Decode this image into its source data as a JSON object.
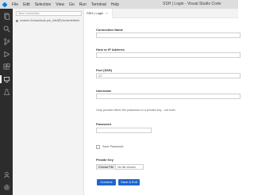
{
  "window": {
    "title": "SSH | Login - Visual Studio Code",
    "menu": [
      "File",
      "Edit",
      "Selection",
      "View",
      "Go",
      "Run",
      "Terminal",
      "Help"
    ]
  },
  "sidebar": {
    "search_placeholder": "Save connection",
    "items": [
      {
        "label": "modem-2x/macbook-pro_Intel(R)/home/redtest"
      }
    ]
  },
  "editor": {
    "tab_label": "SSH | Login",
    "form": {
      "connection_name_label": "Connection Name",
      "connection_name_value": "",
      "host_label": "Host or IP Address",
      "host_value": "",
      "port_label": "Port (SSH)",
      "port_value": "22",
      "username_label": "Username",
      "username_value": "",
      "hint": "Only provide either the password or a private key - not both.",
      "password_label": "Password",
      "password_value": "",
      "save_password_label": "Save Password",
      "private_key_label": "Private Key",
      "choose_file_label": "Choose File",
      "file_status": "No file chosen",
      "connect_label": "Connect",
      "save_exit_label": "Save & Exit"
    }
  },
  "colors": {
    "activity_bar": "#2c2c2c",
    "sidebar": "#f3f3f3",
    "primary_button": "#1e66d0",
    "titlebar": "#dddddd"
  }
}
